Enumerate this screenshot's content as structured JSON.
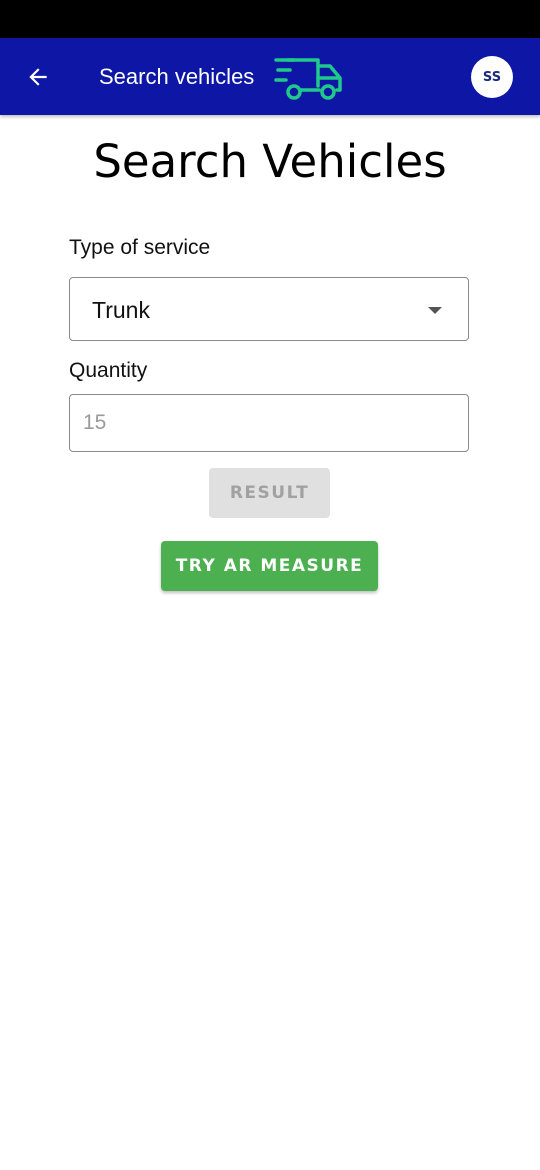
{
  "header": {
    "title": "Search vehicles",
    "avatar_initials": "SS",
    "back_icon": "arrow-left-icon",
    "logo_icon": "delivery-truck-icon",
    "background_color": "#0d16a5",
    "logo_color": "#1fc98a"
  },
  "page": {
    "title": "Search Vehicles"
  },
  "form": {
    "service_label": "Type of service",
    "service_value": "Trunk",
    "quantity_label": "Quantity",
    "quantity_placeholder": "15",
    "result_button": "RESULT",
    "ar_button": "TRY AR MEASURE"
  },
  "colors": {
    "primary_button": "#4caf50",
    "disabled_button": "#e0e0e0"
  }
}
